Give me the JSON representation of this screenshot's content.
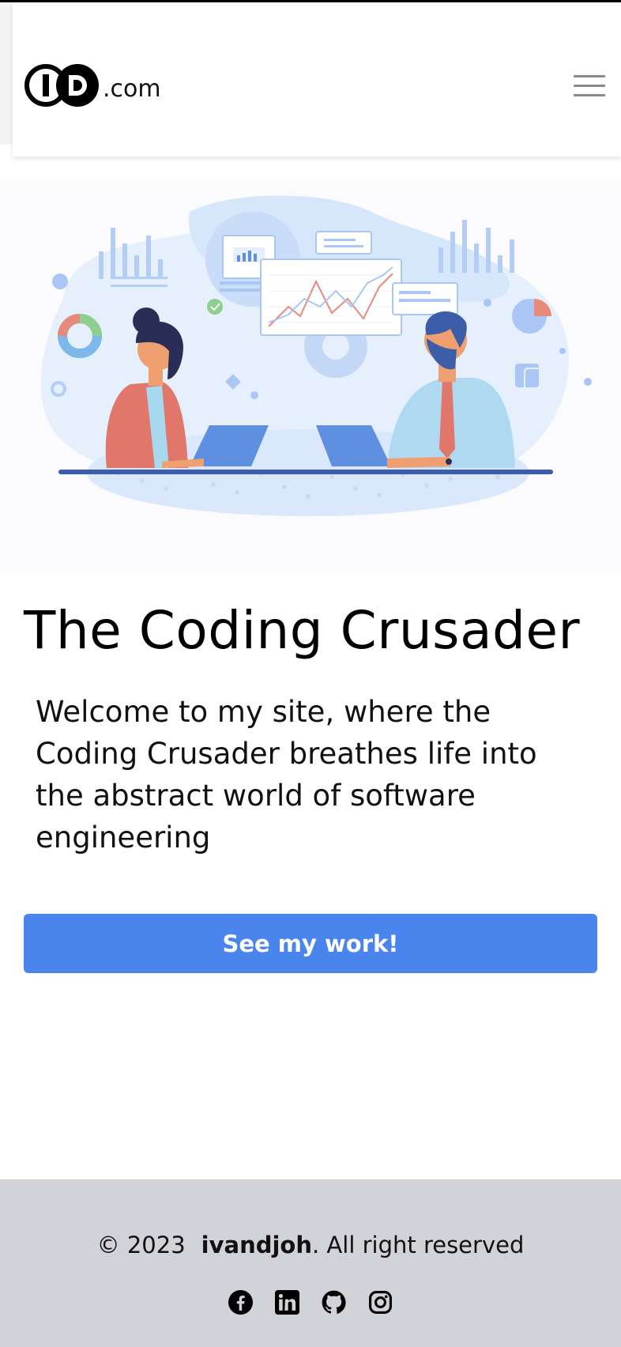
{
  "brand": {
    "logo_letters": "ID",
    "domain": ".com"
  },
  "nav": {
    "menu_icon": "hamburger-icon"
  },
  "hero": {
    "illustration": "team-collaboration-illustration",
    "title": "The Coding Crusader",
    "intro": "Welcome to my site, where the Coding Crusader breathes life into the abstract world of software engineering",
    "cta_label": "See my work!"
  },
  "footer": {
    "copyright_prefix": "© 2023",
    "owner": "ivandjoh",
    "copyright_suffix": ". All right reserved",
    "social_icons": [
      "facebook-icon",
      "linkedin-icon",
      "github-icon",
      "instagram-icon"
    ]
  },
  "colors": {
    "accent": "#4a85ee",
    "footer_bg": "#d2d3d8"
  }
}
